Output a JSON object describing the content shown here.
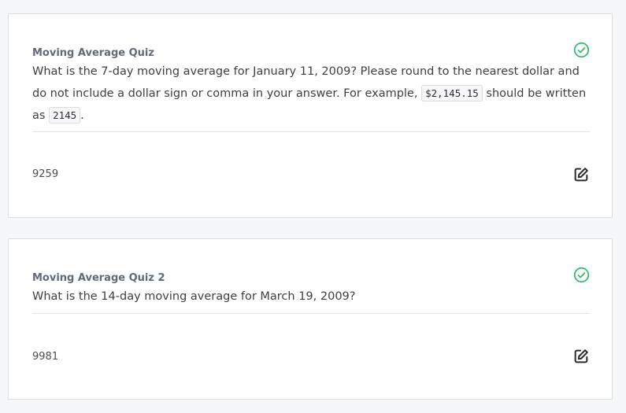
{
  "colors": {
    "check": "#2dbb6a",
    "text": "#3c4043",
    "title": "#5f6b78",
    "icon_dark": "#2b2b2b"
  },
  "quizzes": [
    {
      "title": "Moving Average Quiz",
      "question_part1": "What is the 7-day moving average for January 11, 2009? Please round to the nearest dollar and do not include a dollar sign or comma in your answer. For example, ",
      "example_code": "$2,145.15",
      "question_part2": " should be written as ",
      "answer_code": "2145",
      "question_part3": ".",
      "answer": "9259",
      "status_icon": "check-circle-icon",
      "action_icon": "edit-icon"
    },
    {
      "title": "Moving Average Quiz 2",
      "question": "What is the 14-day moving average for March 19, 2009?",
      "answer": "9981",
      "status_icon": "check-circle-icon",
      "action_icon": "edit-icon"
    }
  ]
}
